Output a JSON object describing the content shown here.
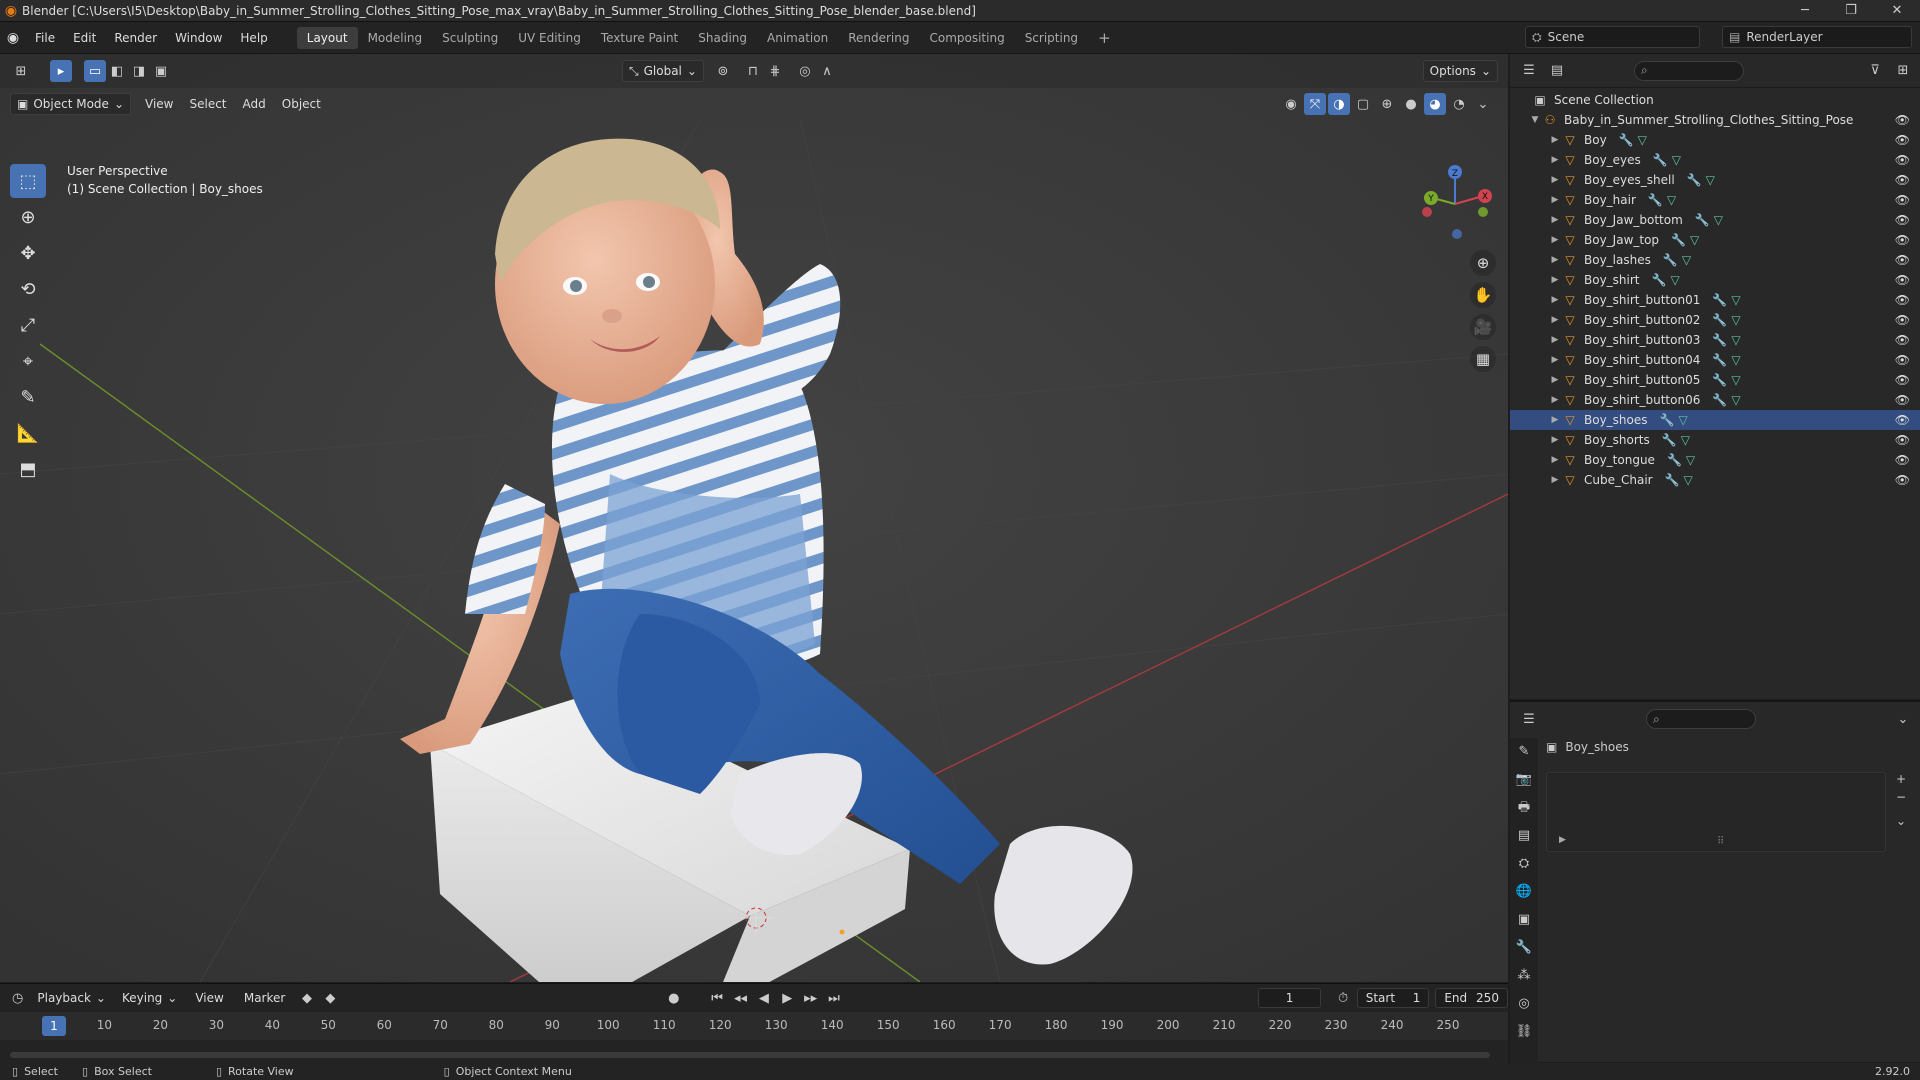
{
  "title": "Blender [C:\\Users\\I5\\Desktop\\Baby_in_Summer_Strolling_Clothes_Sitting_Pose_max_vray\\Baby_in_Summer_Strolling_Clothes_Sitting_Pose_blender_base.blend]",
  "menu": [
    "File",
    "Edit",
    "Render",
    "Window",
    "Help"
  ],
  "workspaces": [
    "Layout",
    "Modeling",
    "Sculpting",
    "UV Editing",
    "Texture Paint",
    "Shading",
    "Animation",
    "Rendering",
    "Compositing",
    "Scripting"
  ],
  "active_workspace": "Layout",
  "scene": "Scene",
  "render_layer": "RenderLayer",
  "viewport": {
    "transform_orientation": "Global",
    "options": "Options",
    "mode": "Object Mode",
    "menus": [
      "View",
      "Select",
      "Add",
      "Object"
    ],
    "overlay_line1": "User Perspective",
    "overlay_line2": "(1) Scene Collection | Boy_shoes"
  },
  "outliner": {
    "root": "Scene Collection",
    "collection": "Baby_in_Summer_Strolling_Clothes_Sitting_Pose",
    "objects": [
      "Boy",
      "Boy_eyes",
      "Boy_eyes_shell",
      "Boy_hair",
      "Boy_Jaw_bottom",
      "Boy_Jaw_top",
      "Boy_lashes",
      "Boy_shirt",
      "Boy_shirt_button01",
      "Boy_shirt_button02",
      "Boy_shirt_button03",
      "Boy_shirt_button04",
      "Boy_shirt_button05",
      "Boy_shirt_button06",
      "Boy_shoes",
      "Boy_shorts",
      "Boy_tongue",
      "Cube_Chair"
    ]
  },
  "properties": {
    "object_name": "Boy_shoes"
  },
  "timeline": {
    "menus": [
      "Playback",
      "Keying",
      "View",
      "Marker"
    ],
    "current_frame": "1",
    "start_label": "Start",
    "start": "1",
    "end_label": "End",
    "end": "250",
    "ticks": [
      "1",
      "10",
      "20",
      "30",
      "40",
      "50",
      "60",
      "70",
      "80",
      "90",
      "100",
      "110",
      "120",
      "130",
      "140",
      "150",
      "160",
      "170",
      "180",
      "190",
      "200",
      "210",
      "220",
      "230",
      "240",
      "250"
    ]
  },
  "status": {
    "select": "Select",
    "box_select": "Box Select",
    "rotate_view": "Rotate View",
    "context_menu": "Object Context Menu",
    "version": "2.92.0"
  }
}
